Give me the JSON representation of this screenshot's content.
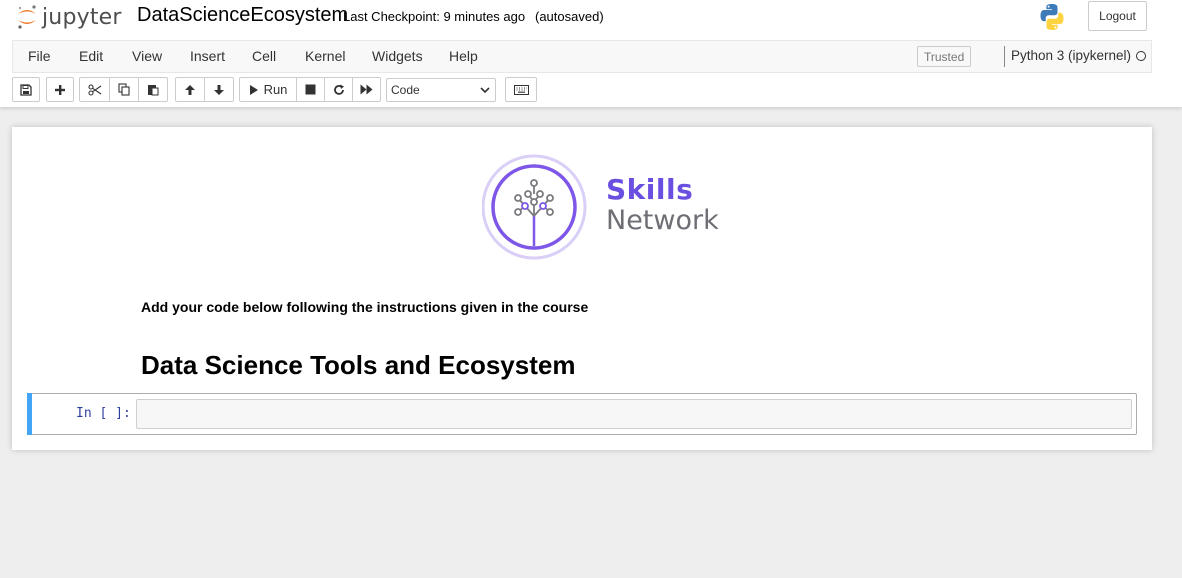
{
  "header": {
    "logo_text": "jupyter",
    "notebook_name": "DataScienceEcosystem",
    "checkpoint": "Last Checkpoint: 9 minutes ago",
    "autosave": "(autosaved)",
    "logout_label": "Logout"
  },
  "menubar": {
    "items": [
      "File",
      "Edit",
      "View",
      "Insert",
      "Cell",
      "Kernel",
      "Widgets",
      "Help"
    ],
    "trusted": "Trusted",
    "kernel_name": "Python 3 (ipykernel)"
  },
  "toolbar": {
    "run_label": "Run",
    "cell_type": "Code"
  },
  "notebook": {
    "logo_skills": "Skills",
    "logo_network": "Network",
    "instruction": "Add your code below following the instructions given in the course",
    "heading": "Data Science Tools and Ecosystem",
    "prompt": "In [ ]:"
  },
  "colors": {
    "accent": "#42a5f5",
    "skills_purple": "#6b4fe0",
    "prompt_blue": "#303f9f"
  },
  "icons": [
    "save-icon",
    "plus-icon",
    "scissors-icon",
    "copy-icon",
    "paste-icon",
    "arrow-up-icon",
    "arrow-down-icon",
    "play-icon",
    "stop-icon",
    "restart-icon",
    "fast-forward-icon",
    "keyboard-icon",
    "python-logo-icon",
    "jupyter-logo-icon"
  ]
}
